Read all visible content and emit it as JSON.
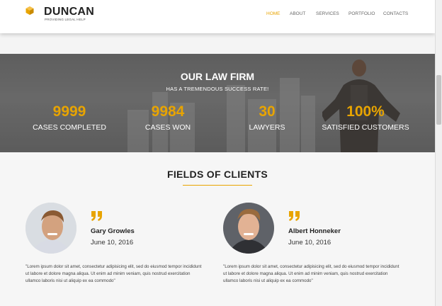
{
  "brand": {
    "name": "DUNCAN",
    "tagline": "PROVIDING LEGAL HELP",
    "accent": "#e8a400"
  },
  "nav": [
    {
      "label": "HOME",
      "active": true
    },
    {
      "label": "ABOUT",
      "active": false
    },
    {
      "label": "SERVICES",
      "active": false
    },
    {
      "label": "PORTFOLIO",
      "active": false
    },
    {
      "label": "CONTACTS",
      "active": false
    }
  ],
  "banner": {
    "title": "OUR LAW FIRM",
    "subtitle": "HAS A TREMENDOUS SUCCESS RATE!",
    "stats": [
      {
        "value": "9999",
        "label": "CASES COMPLETED"
      },
      {
        "value": "9984",
        "label": "CASES WON"
      },
      {
        "value": "30",
        "label": "LAWYERS"
      },
      {
        "value": "100%",
        "label": "SATISFIED CUSTOMERS"
      }
    ]
  },
  "clients": {
    "title": "FIELDS OF CLIENTS",
    "items": [
      {
        "name": "Gary Growles",
        "date": "June 10, 2016",
        "text": "\"Lorem ipsum dolor sit amet, consectetur adipisicing elit, sed do eiusmod tempor incididunt ut labore et dolore magna aliqua. Ut enim ad minim veniam, quis nostrud exercitation ullamco laboris nisi ut aliquip ex ea commodo\""
      },
      {
        "name": "Albert Honneker",
        "date": "June 10, 2016",
        "text": "\"Lorem ipsum dolor sit amet, consectetur adipisicing elit, sed do eiusmod tempor incididunt ut labore et dolore magna aliqua. Ut enim ad minim veniam, quis nostrud exercitation ullamco laboris nisi ut aliquip ex ea commodo\""
      }
    ]
  },
  "icons": {
    "logo": "hexagon-cube-icon",
    "quote": "quote-icon"
  }
}
